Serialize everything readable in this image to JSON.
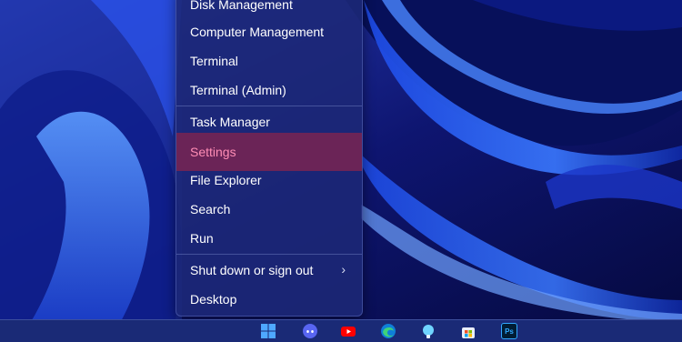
{
  "context_menu": {
    "items": [
      {
        "label": "Disk Management"
      },
      {
        "label": "Computer Management"
      },
      {
        "label": "Terminal"
      },
      {
        "label": "Terminal (Admin)"
      },
      {
        "label": "Task Manager"
      },
      {
        "label": "Settings",
        "state": "hovered"
      },
      {
        "label": "File Explorer"
      },
      {
        "label": "Search"
      },
      {
        "label": "Run"
      },
      {
        "label": "Shut down or sign out",
        "submenu_indicator": "›"
      },
      {
        "label": "Desktop"
      }
    ],
    "colors": {
      "background": "#1c2876",
      "hover_background": "#6b2457",
      "hover_text": "#ff8db5",
      "text": "#ffffff"
    }
  },
  "taskbar": {
    "icons": [
      "windows-start-icon",
      "discord-icon",
      "youtube-icon",
      "edge-icon",
      "light-bulb-icon",
      "microsoft-store-icon",
      "photoshop-icon"
    ],
    "photoshop_label": "Ps"
  },
  "wallpaper": {
    "colors": [
      "#0a0f5a",
      "#1a3fe0",
      "#4a86ff"
    ]
  }
}
